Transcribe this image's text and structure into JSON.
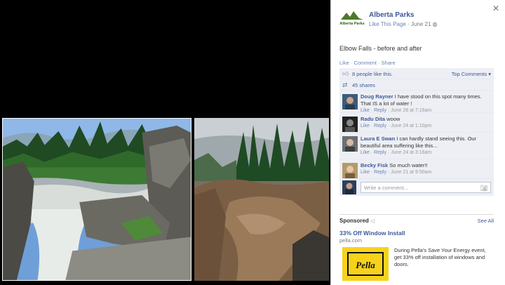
{
  "post": {
    "page_name": "Alberta Parks",
    "logo_text": "Alberta Parks",
    "like_page": "Like This Page",
    "date": "June 21",
    "caption": "Elbow Falls - before and after"
  },
  "actions": {
    "like": "Like",
    "comment": "Comment",
    "share": "Share",
    "sep": "·"
  },
  "stats": {
    "likes": "8 people like this.",
    "top_comments": "Top Comments",
    "shares": "45 shares"
  },
  "comments": [
    {
      "name": "Doug Rayner",
      "text": "I have stood on this spot many times. That IS a lot of water !",
      "like": "Like",
      "reply": "Reply",
      "time": "June 28 at 7:16am"
    },
    {
      "name": "Radu Dita",
      "text": "woow",
      "like": "Like",
      "reply": "Reply",
      "time": "June 24 at 1:10pm"
    },
    {
      "name": "Laura E Swan",
      "text": "I can hardly stand seeing this. Our beautiful area suffering like this...",
      "like": "Like",
      "reply": "Reply",
      "time": "June 24 at 3:16am"
    },
    {
      "name": "Becky Fisk",
      "text": "So much water!!",
      "like": "Like",
      "reply": "Reply",
      "time": "June 21 at 9:50am"
    }
  ],
  "write_comment": {
    "placeholder": "Write a comment..."
  },
  "sponsored": {
    "label": "Sponsored",
    "see_all": "See All",
    "ad_title": "33% Off Window Install",
    "ad_domain": "pella.com",
    "ad_text": "During Pella's Save Your Energy event, get 33% off installation of windows and doors.",
    "ad_logo_text": "Pella"
  },
  "icons": {
    "close": "close-icon",
    "like": "thumbs-up-icon",
    "share": "share-icon",
    "camera": "camera-icon",
    "sponsored": "megaphone-icon"
  },
  "colors": {
    "link": "#3b5998",
    "panel_bg": "#edeff4",
    "ad_yellow": "#f6d21b"
  }
}
